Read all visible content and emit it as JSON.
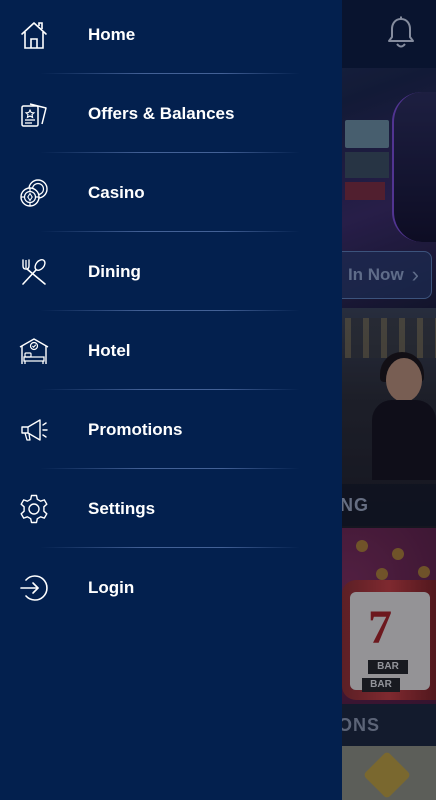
{
  "background": {
    "join_button_label": "In Now",
    "join_button_chevron": "›",
    "dining_banner_label": "NG",
    "promotions_banner_label": "TIONS",
    "slot_seven": "7",
    "slot_bar_1": "BAR",
    "slot_bar_2": "BAR",
    "bell_icon": "bell-icon"
  },
  "drawer": {
    "items": [
      {
        "label": "Home",
        "icon": "home-icon"
      },
      {
        "label": "Offers & Balances",
        "icon": "offers-icon"
      },
      {
        "label": "Casino",
        "icon": "casino-chips-icon"
      },
      {
        "label": "Dining",
        "icon": "dining-icon"
      },
      {
        "label": "Hotel",
        "icon": "hotel-icon"
      },
      {
        "label": "Promotions",
        "icon": "megaphone-icon"
      },
      {
        "label": "Settings",
        "icon": "gear-icon"
      },
      {
        "label": "Login",
        "icon": "login-icon"
      }
    ]
  },
  "colors": {
    "drawer_bg": "#03204e",
    "text": "#ffffff",
    "divider": "#7896d2"
  }
}
